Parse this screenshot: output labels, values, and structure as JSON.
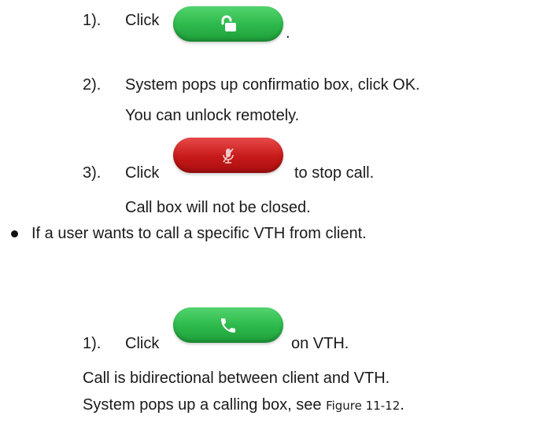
{
  "steps": [
    {
      "num": "1).",
      "prefix": "Click",
      "suffix": ".",
      "icon": "unlock-icon"
    },
    {
      "num": "2).",
      "line1": "System pops up confirmatio box, click OK.",
      "line2": "You can unlock remotely."
    },
    {
      "num": "3).",
      "prefix": "Click",
      "suffix": "to stop call.",
      "icon": "mic-off-icon",
      "note": "Call box will not be closed."
    }
  ],
  "bullet_text": "If a user wants to call a specific VTH from client.",
  "call_step": {
    "num": "1).",
    "prefix": "Click",
    "suffix": "on VTH.",
    "icon": "phone-icon",
    "line1": "Call is bidirectional between client and VTH.",
    "line2_prefix": "System pops up a calling box, see",
    "line2_ref": "Figure 11-12",
    "line2_end": "."
  },
  "colors": {
    "green": "#2cb84a",
    "red": "#c71919"
  }
}
